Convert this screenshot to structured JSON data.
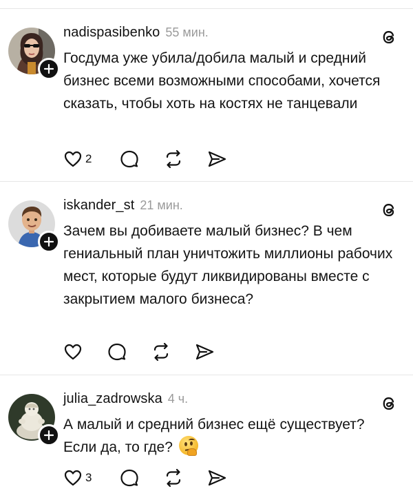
{
  "posts": [
    {
      "username": "nadispasibenko",
      "time": "55 мин.",
      "text": "Госдума уже убила/добила малый и средний бизнес всеми возможными способами, хочется сказать, чтобы хоть на костях не танцевали",
      "like_count": "2",
      "avatar_icon": "avatar-woman-sunglasses",
      "emoji": ""
    },
    {
      "username": "iskander_st",
      "time": "21 мин.",
      "text": "Зачем вы добиваете малый бизнес? В чем гениальный план уничтожить миллионы рабочих мест, которые будут ликвидированы вместе с закрытием малого бизнеса?",
      "like_count": "",
      "avatar_icon": "avatar-cartoon-man",
      "emoji": ""
    },
    {
      "username": "julia_zadrowska",
      "time": "4 ч.",
      "text": "А малый и средний бизнес ещё существует? Если да, то где?",
      "like_count": "3",
      "avatar_icon": "avatar-figurine",
      "emoji": "thinking-face"
    }
  ],
  "icons": {
    "like": "heart-icon",
    "reply": "comment-icon",
    "repost": "repost-icon",
    "share": "send-icon",
    "follow": "plus-icon",
    "app": "threads-icon"
  },
  "colors": {
    "text": "#111111",
    "muted": "#9a9a9a",
    "divider": "#e6e6e6"
  }
}
